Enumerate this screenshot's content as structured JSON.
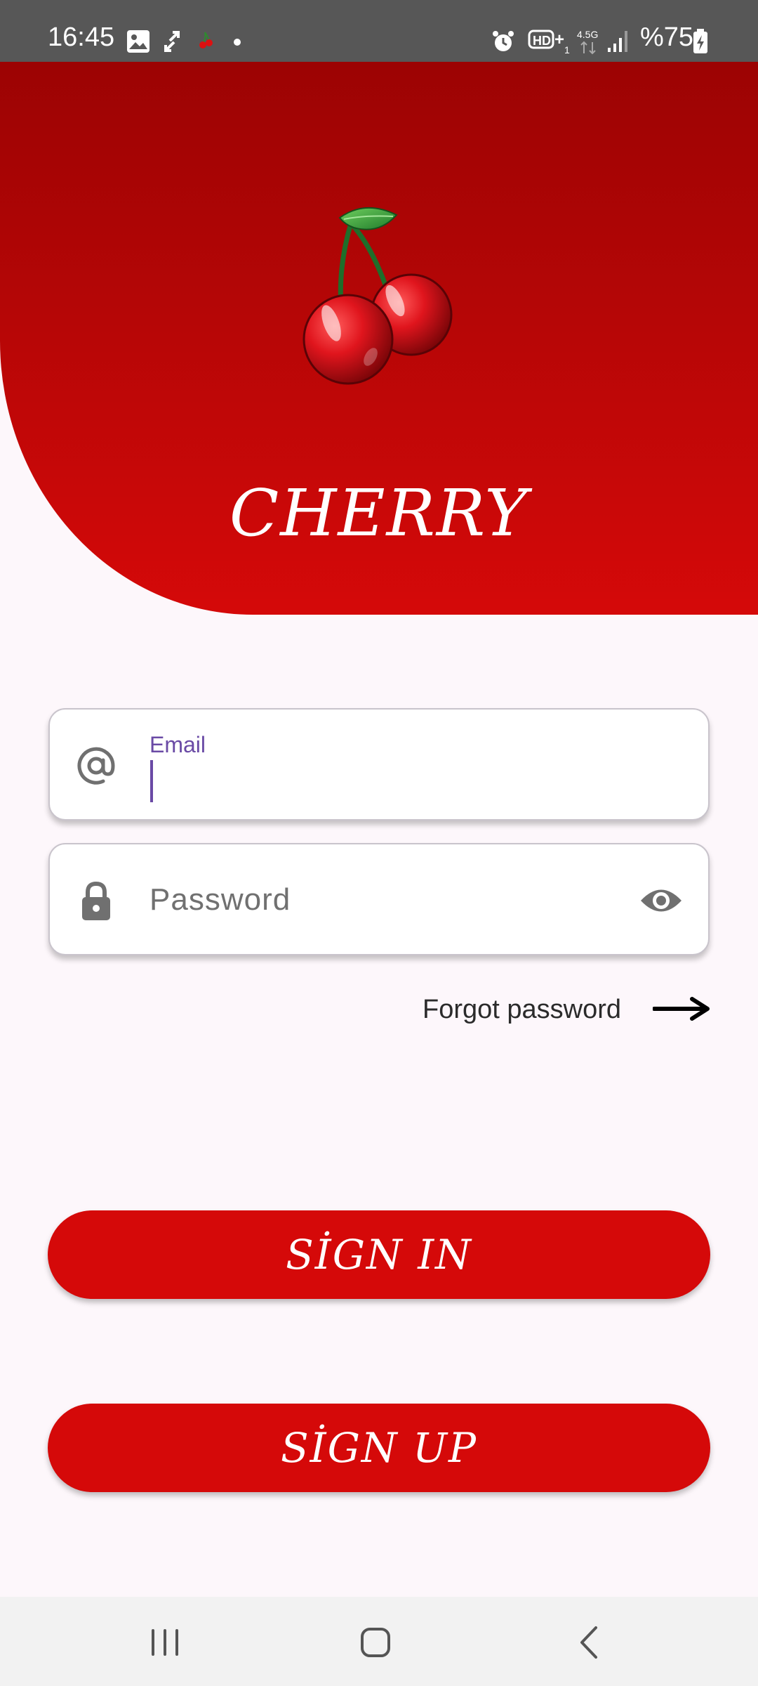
{
  "status_bar": {
    "time": "16:45",
    "battery": "%75",
    "icons": [
      "gallery-icon",
      "sync-icon",
      "cherry-notification-icon",
      "dot-icon",
      "alarm-icon",
      "hd-voice-icon",
      "network-4.5g-icon",
      "signal-icon",
      "battery-charging-icon"
    ],
    "hd_label": "HD+1",
    "network_label": "4.5G"
  },
  "hero": {
    "title": "CHERRY",
    "logo_icon": "cherry-logo",
    "gradient_top": "#9c0303",
    "gradient_bottom": "#d50909"
  },
  "form": {
    "email": {
      "label": "Email",
      "value": "",
      "icon": "at-icon",
      "state": "focused"
    },
    "password": {
      "placeholder": "Password",
      "value": "",
      "icon": "lock-icon",
      "toggle_icon": "eye-icon"
    },
    "forgot": {
      "label": "Forgot password",
      "icon": "arrow-right-icon"
    }
  },
  "buttons": {
    "sign_in": "SİGN IN",
    "sign_up": "SİGN UP",
    "color": "#d50909"
  },
  "nav_bar": {
    "items": [
      "recent-apps-icon",
      "home-icon",
      "back-icon"
    ]
  }
}
